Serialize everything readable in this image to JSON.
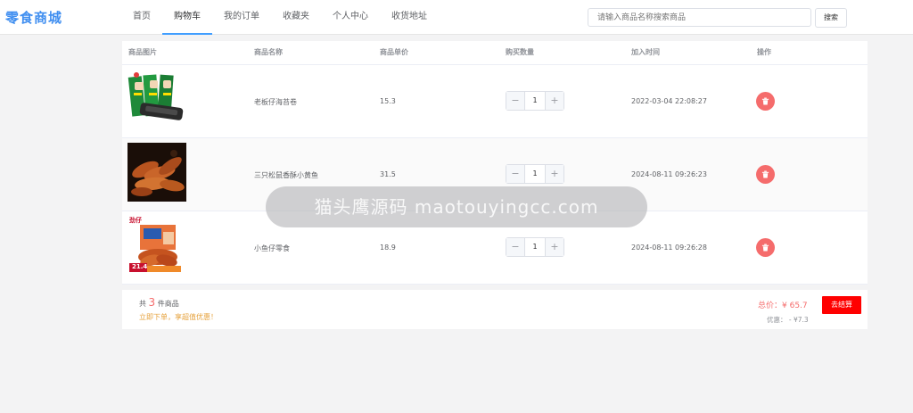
{
  "header": {
    "logo": "零食商城",
    "nav": [
      "首页",
      "购物车",
      "我的订单",
      "收藏夹",
      "个人中心",
      "收货地址"
    ],
    "search_placeholder": "请输入商品名称搜索商品",
    "search_button": "搜索"
  },
  "table": {
    "columns": [
      "商品图片",
      "商品名称",
      "商品单价",
      "购买数量",
      "加入时间",
      "操作"
    ],
    "rows": [
      {
        "name": "老板仔海苔卷",
        "price": "15.3",
        "quantity": "1",
        "added": "2022-03-04 22:08:27",
        "image_icon": "seaweed-roll-photo"
      },
      {
        "name": "三只松鼠香酥小黄鱼",
        "price": "31.5",
        "quantity": "1",
        "added": "2024-08-11 09:26:23",
        "image_icon": "crispy-fish-photo"
      },
      {
        "name": "小鱼仔零食",
        "price": "18.9",
        "quantity": "1",
        "added": "2024-08-11 09:26:28",
        "image_icon": "small-fish-snack-photo",
        "image_badge": "21.4",
        "image_brand": "劲仔"
      }
    ],
    "stepper_minus": "−",
    "stepper_plus": "+"
  },
  "summary": {
    "count_prefix": "共",
    "count": "3",
    "count_suffix": "件商品",
    "promo": "立即下单，享超值优惠！",
    "total_label": "总价：",
    "total_value": "¥ 65.7",
    "discount": "优惠： - ¥7.3",
    "checkout": "去结算"
  },
  "watermark": "猫头鹰源码 maotouyingcc.com",
  "colors": {
    "brand": "#3f8ef0",
    "danger": "#f56c6c",
    "checkout": "#ff0000",
    "promo": "#e6a23c"
  }
}
